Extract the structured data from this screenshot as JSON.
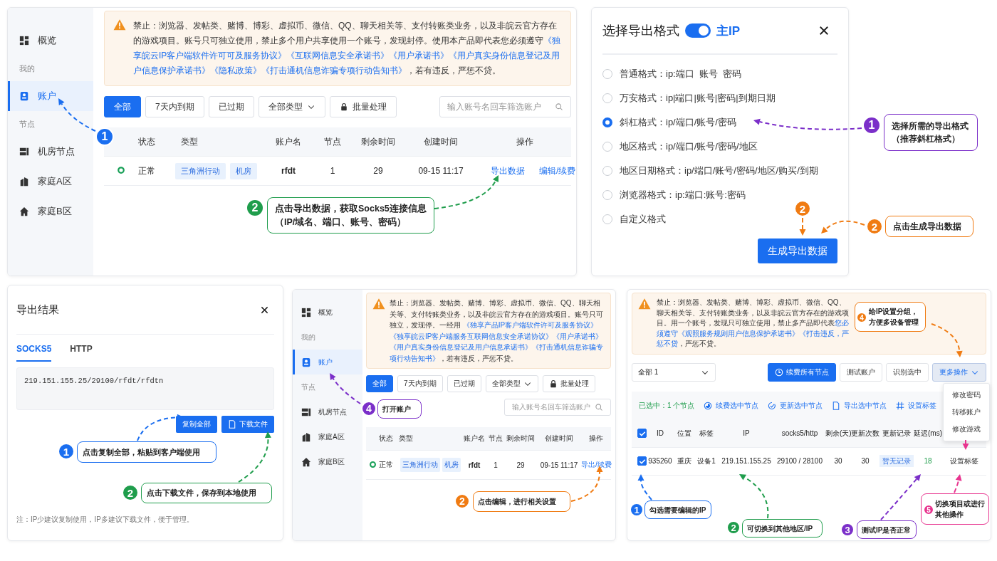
{
  "account_page": {
    "sidebar": [
      {
        "kind": "item",
        "label": "概览",
        "selected": false
      },
      {
        "kind": "section",
        "label": "我的"
      },
      {
        "kind": "item",
        "label": "账户",
        "selected": true
      },
      {
        "kind": "section",
        "label": "节点"
      },
      {
        "kind": "item",
        "label": "机房节点",
        "selected": false
      },
      {
        "kind": "item",
        "label": "家庭A区",
        "selected": false
      },
      {
        "kind": "item",
        "label": "家庭B区",
        "selected": false
      }
    ],
    "notice": [
      {
        "text": "禁止：浏览器、发帖类、赌博、博彩、虚拟币、微信、QQ、聊天相关等、支付转账类业务，以及非皖云官方存在的游戏项目。账号只可独立使用，禁止多个用户共享使用一个账号，发现封停。使用本产品即代表您必须遵守",
        "link": false
      },
      {
        "text": "《独享皖云IP客户端软件许可可及服务协议》",
        "link": true
      },
      {
        "text": "《互联网信息安全承诺书》",
        "link": true
      },
      {
        "text": "《用户承诺书》",
        "link": true
      },
      {
        "text": "《用户真实身份信息登记及用户信息保护承诺书》",
        "link": true
      },
      {
        "text": "《隐私政策》",
        "link": true
      },
      {
        "text": "《打击通机信息诈骗专项行动告知书》",
        "link": true
      },
      {
        "text": "，若有违反，严惩不贷。",
        "link": false
      }
    ],
    "filters": [
      {
        "label": "全部",
        "selected": true
      },
      {
        "label": "7天内到期",
        "selected": false
      },
      {
        "label": "已过期",
        "selected": false
      }
    ],
    "type_filter": "全部类型",
    "batch_button": "批量处理",
    "search": {
      "placeholder": "输入账号名回车筛选账户"
    },
    "table": {
      "columns": [
        "状态",
        "类型",
        "账户名",
        "节点",
        "剩余时间",
        "创建时间",
        "操作"
      ],
      "rows": [
        {
          "status": "正常",
          "tags": [
            "三角洲行动",
            "机房"
          ],
          "name": "rfdt",
          "nodes": "1",
          "remaining": "29",
          "created": "09-15 11:17",
          "actions": [
            "导出数据",
            "编辑/续费"
          ]
        }
      ]
    },
    "callouts": [
      {
        "number": "1",
        "color": "#1a6ef0"
      },
      {
        "number": "2",
        "text": "点击导出数据，获取Socks5连接信息（IP/域名、端口、账号、密码）",
        "color": "#1f9d4c"
      }
    ]
  },
  "export_format_dialog": {
    "title": "选择导出格式",
    "toggle": {
      "on": true,
      "label": "主IP"
    },
    "formats": [
      {
        "label": "普通格式：ip:端口  账号  密码",
        "selected": false
      },
      {
        "label": "万安格式：ip|端口|账号|密码|到期日期",
        "selected": false
      },
      {
        "label": "斜杠格式：ip/端口/账号/密码",
        "selected": true
      },
      {
        "label": "地区格式：ip/端口/账号/密码/地区",
        "selected": false
      },
      {
        "label": "地区日期格式：ip/端口/账号/密码/地区/购买/到期",
        "selected": false
      },
      {
        "label": "浏览器格式：ip:端口:账号:密码",
        "selected": false
      },
      {
        "label": "自定义格式",
        "selected": false
      }
    ],
    "generate_button": "生成导出数据",
    "callouts": [
      {
        "number": "1",
        "text": "选择所需的导出格式（推荐斜杠格式）",
        "color": "#7b2fc9"
      },
      {
        "number": "2",
        "color": "#f07b12"
      },
      {
        "number": "2",
        "text": "点击生成导出数据",
        "color": "#f07b12"
      }
    ]
  },
  "export_result_dialog": {
    "title": "导出结果",
    "tabs": [
      {
        "label": "SOCKS5",
        "selected": true
      },
      {
        "label": "HTTP",
        "selected": false
      }
    ],
    "result_text": "219.151.155.25/29100/rfdt/rfdtn",
    "buttons": [
      {
        "kind": "copy",
        "label": "复制全部"
      },
      {
        "kind": "download",
        "label": "下载文件"
      }
    ],
    "note": "注：IP少建议复制使用，IP多建议下载文件，便于管理。",
    "callouts": [
      {
        "number": "1",
        "text": "点击复制全部，粘贴到客户端使用",
        "color": "#1a6ef0"
      },
      {
        "number": "2",
        "text": "点击下载文件，保存到本地使用",
        "color": "#1f9d4c"
      }
    ]
  },
  "account_page_small": {
    "sidebar": [
      {
        "kind": "item",
        "label": "概览",
        "selected": false
      },
      {
        "kind": "section",
        "label": "我的"
      },
      {
        "kind": "item",
        "label": "账户",
        "selected": true
      },
      {
        "kind": "section",
        "label": "节点"
      },
      {
        "kind": "item",
        "label": "机房节点",
        "selected": false
      },
      {
        "kind": "item",
        "label": "家庭A区",
        "selected": false
      },
      {
        "kind": "item",
        "label": "家庭B区",
        "selected": false
      }
    ],
    "notice": [
      {
        "text": "禁止：浏览器、发帖类、赌博、博彩、虚拟币、微信、QQ、聊天相关等、支付转账类业务，以及非皖云官方存在的游戏项目。账号只可独立，发现停。一经用 ",
        "link": false
      },
      {
        "text": "《独享产品IP客户端软件许可及服务协议》",
        "link": true
      },
      {
        "text": "《独享皖云IP客户端服务互联网信息安全承诺协议》",
        "link": true
      },
      {
        "text": "《用户承诺书》",
        "link": true
      },
      {
        "text": "《用户真实身份信息登记及用户信息承诺书》",
        "link": true
      },
      {
        "text": "《打击通机信息诈骗专项行动告知书》",
        "link": true
      },
      {
        "text": "，若有违反，严惩不贷。",
        "link": false
      }
    ],
    "filters": [
      {
        "label": "全部",
        "selected": true
      },
      {
        "label": "7天内到期",
        "selected": false
      },
      {
        "label": "已过期",
        "selected": false
      }
    ],
    "type_filter": "全部类型",
    "batch_button": "批量处理",
    "search": {
      "placeholder": "输入账号名回车筛选账户"
    },
    "table": {
      "columns": [
        "状态",
        "类型",
        "账户名",
        "节点",
        "剩余时间",
        "创建时间",
        "操作"
      ],
      "rows": [
        {
          "status": "正常",
          "tags": [
            "三角洲行动",
            "机房"
          ],
          "name": "rfdt",
          "nodes": "1",
          "remaining": "29",
          "created": "09-15 11:17",
          "actions": [
            "导出/续费"
          ]
        }
      ]
    },
    "callouts": [
      {
        "number": "4",
        "text": "打开账户",
        "color": "#7b2fc9"
      },
      {
        "number": "2",
        "text": "点击编辑，进行相关设置",
        "color": "#f07b12"
      }
    ]
  },
  "node_page": {
    "notice": [
      {
        "text": "禁止：浏览器、发帖类、赌博、博彩、虚拟币、微信、QQ、聊天相关等、支付转账类业务，以及非皖云官方存在的游戏项目。用一个账号，发现只可独立使用，禁止多产品即代表",
        "link": false
      },
      {
        "text": "您必须遵守《观照服务规则用户信息保护承诺书》《打击违反，严惩不贷",
        "link": true
      },
      {
        "text": "，严惩不贷。",
        "link": false
      }
    ],
    "group_select": "全部 1",
    "buttons": [
      {
        "kind": "primary",
        "label": "续费所有节点"
      },
      {
        "kind": "plain",
        "label": "测试账户"
      },
      {
        "kind": "plain",
        "label": "识别选中"
      },
      {
        "kind": "menu",
        "label": "更多操作",
        "expanded": true
      }
    ],
    "menu_items": [
      "修改密码",
      "转移账户",
      "修改游戏"
    ],
    "selection": {
      "count_text": "已选中：1 个节点",
      "actions": [
        {
          "kind": "renew",
          "label": "续费选中节点"
        },
        {
          "kind": "update",
          "label": "更新选中节点"
        },
        {
          "kind": "export",
          "label": "导出选中节点"
        },
        {
          "kind": "tag",
          "label": "设置标签"
        }
      ]
    },
    "table": {
      "header_checked": true,
      "columns": [
        "ID",
        "位置",
        "标签",
        "IP",
        "socks5/http",
        "剩余(天)",
        "更新次数",
        "更新记录",
        "延迟(ms)"
      ],
      "rows": [
        {
          "checked": true,
          "id": "935260",
          "location": "重庆",
          "tag": "设备1",
          "ip": "219.151.155.25",
          "ports": "29100 / 28100",
          "days_left": "30",
          "updates": "30",
          "record": "暂无记录",
          "latency": "18",
          "action": "设置标签"
        }
      ]
    },
    "callouts": [
      {
        "number": "4",
        "text": "给IP设置分组，方便多设备管理",
        "color": "#f07b12"
      },
      {
        "number": "1",
        "text": "勾选需要编辑的IP",
        "color": "#1a6ef0"
      },
      {
        "number": "2",
        "text": "可切换到其他地区/IP",
        "color": "#1f9d4c"
      },
      {
        "number": "3",
        "text": "测试IP是否正常",
        "color": "#7b2fc9"
      },
      {
        "number": "5",
        "text": "切换项目或进行其他操作",
        "color": "#e8348f"
      }
    ]
  }
}
